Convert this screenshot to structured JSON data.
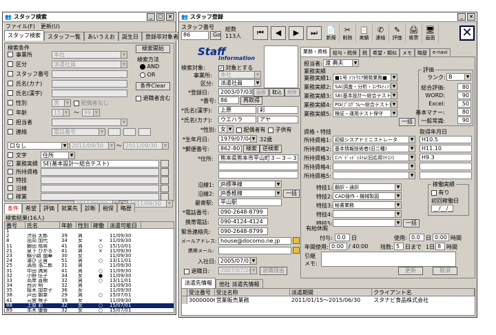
{
  "left": {
    "title": "スタッフ検索",
    "menu": [
      "ファイル(F)",
      "更新(U)"
    ],
    "tabs": [
      "スタッフ検索",
      "スタッフ一覧",
      "あいうえお",
      "誕生日",
      "登録非対象者"
    ],
    "cond_header": "検索条件",
    "search_btn": "検索開始",
    "method_label": "検索方法",
    "and": "AND",
    "or": "OR",
    "clear_btn": "条件Clear",
    "retired": "退職者含む",
    "fields": [
      {
        "label": "事業所",
        "value": "本社",
        "type": "select",
        "check": false,
        "dis": true
      },
      {
        "label": "区分",
        "value": "派遣社員",
        "type": "select",
        "check": true,
        "dis": true
      },
      {
        "label": "スタッフ番号",
        "value": "",
        "type": "text",
        "check": true,
        "dis": true
      },
      {
        "label": "氏名(カナ)",
        "value": "",
        "type": "text",
        "check": true,
        "dis": true
      },
      {
        "label": "氏名(漢字)",
        "value": "",
        "type": "text",
        "check": true,
        "dis": true
      },
      {
        "label": "性別",
        "value": "男",
        "type": "select",
        "check": true,
        "dis": true,
        "extra": "配偶者なし"
      },
      {
        "label": "年齢",
        "value": "15",
        "type": "range",
        "check": true,
        "dis": true,
        "to": "99"
      },
      {
        "label": "担当者",
        "value": "",
        "type": "select",
        "check": true,
        "dis": true
      },
      {
        "label": "連絡",
        "value": "電話番号",
        "type": "select",
        "check": true,
        "dis": true
      }
    ],
    "and_none": "口なし",
    "date_from": "2011/09/30",
    "date_to": "2011/09/30",
    "bottom_fields": [
      {
        "label": "文字",
        "value": "住所",
        "check": false
      },
      {
        "label": "業務実績",
        "value": "SE(基本設計～総合テスト)",
        "check": true
      },
      {
        "label": "所持資格",
        "value": "",
        "check": false
      },
      {
        "label": "特技",
        "value": "",
        "check": false
      },
      {
        "label": "沿線",
        "value": "",
        "check": false
      },
      {
        "label": "稼業",
        "value": "",
        "check": false
      }
    ],
    "bottom_date_from": "2011/09/30",
    "bottom_date_to": "2011/09/30",
    "subtabs": [
      "条件",
      "希望",
      "評価",
      "就業先",
      "診断",
      "税保",
      "略歴"
    ],
    "result_header": "検索結果(16人)",
    "cols": [
      "番号",
      "氏名",
      "年齢",
      "性別",
      "稼働",
      "派遣可能日"
    ],
    "rows": [
      [
        "1",
        "",
        "",
        "",
        "",
        ""
      ],
      [
        "2",
        "渋谷 太郎",
        "39",
        "男",
        "",
        "11/09/30"
      ],
      [
        "8",
        "出向 加代",
        "34",
        "女",
        "×",
        "11/09/30"
      ],
      [
        "11",
        "銀田 晴男",
        "41",
        "男",
        "○",
        "15/10/01"
      ],
      [
        "21",
        "泉下 ひかる",
        "41",
        "男",
        "×",
        "11/09/30"
      ],
      [
        "23",
        "錦小路 國華",
        "30",
        "女",
        "",
        "11/09/30"
      ],
      [
        "24",
        "濃び 正貴",
        "51",
        "男",
        "○",
        "13/11/01"
      ],
      [
        "25",
        "渦島 浩二郎",
        "31",
        "男",
        "",
        "11/09/30"
      ],
      [
        "31",
        "中田 満男",
        "41",
        "男",
        "○",
        "11/09/30"
      ],
      [
        "32",
        "小野 伍子",
        "34",
        "女",
        "●",
        "11/09/30"
      ],
      [
        "33",
        "高岸 直樹",
        "32",
        "男",
        "○",
        "13/11/01"
      ],
      [
        "34",
        "西沢 明",
        "32",
        "男",
        "",
        "11/09/30"
      ],
      [
        "35",
        "桜木 加奈子",
        "36",
        "女",
        "",
        "11/09/30"
      ],
      [
        "38",
        "戸田 朝幸",
        "29",
        "男",
        "○",
        "15/07/01"
      ],
      [
        "41",
        "元宮 咲子",
        "39",
        "女",
        "",
        "11/09/30"
      ],
      [
        "88",
        "上原 彩",
        "32",
        "女",
        "○",
        "15/07/01"
      ],
      [
        "89",
        "本木 優香",
        "32",
        "女",
        "○",
        "15/07/01"
      ]
    ],
    "selected_row": 15
  },
  "right": {
    "title": "スタッフ登録",
    "staffno_label": "スタッフ番号",
    "staffno": "86",
    "go": "Go",
    "total_label": "総数",
    "total": "113人",
    "tools": [
      {
        "icon": "new",
        "label": "新規"
      },
      {
        "icon": "del",
        "label": "削除"
      },
      {
        "icon": "done",
        "label": "実績"
      },
      {
        "icon": "contact",
        "label": "連絡"
      },
      {
        "icon": "eval",
        "label": "評価"
      },
      {
        "icon": "print",
        "label": "帳票"
      },
      {
        "icon": "screen",
        "label": "画面"
      }
    ],
    "logo1": "Staff",
    "logo2": "Information",
    "target_label": "検索対象:",
    "target": "対象とする",
    "office_label": "事業所:",
    "office": "本社",
    "class_label": "区分:",
    "class": "派遣社員",
    "reg_label": "*登録日:",
    "reg": "2003/07/03",
    "reg_btn1": "画面",
    "reg_btn2": "取込",
    "reg_btn3": "削除",
    "no_label": "*番号:",
    "no": "86",
    "renum": "再取得",
    "kanji_label": "*氏名(漢字):",
    "kanji1": "上原",
    "kanji2": "彩",
    "kana_label": "*氏名(カナ):",
    "kana1": "ウエハラ",
    "kana2": "アヤ",
    "sex_label": "*性別:",
    "sex": "女",
    "spouse": "配偶者有",
    "child": "子供有",
    "birth_label": "*生年月日:",
    "birth": "1979/07/04",
    "age": "32歳",
    "zip_label": "*郵便番号:",
    "zip": "862-8012",
    "zip_search": "検索",
    "zip_conv": "逆検索",
    "addr_label": "*住所:",
    "addr": "熊本県熊本市平山町３－３－３",
    "line1_label": "沿線1:",
    "line1": "JR標準線",
    "line2_label": "沿線2:",
    "line2": "JR香椎線",
    "line_btn": "一括",
    "station_label": "最寄駅:",
    "station": "平山駅",
    "tel_label": "*電話番号:",
    "tel": "090-2648-8799",
    "mobile_label": "携帯電話:",
    "mobile": "090-4124-4124",
    "emerg_label": "緊急連絡先:",
    "emerg": "090-2648-8799",
    "mail_label": "メールアドレス:",
    "mail": "house@docomo.ne.jp",
    "mmail_label": "携帯メール:",
    "mmail": "",
    "join_label": "入社日:",
    "join": "2005/07/03",
    "leave_label": "退職日:",
    "leave": "2007/07/26",
    "leave_btn": "退職理由",
    "rtabs": [
      "業務・資格",
      "給与・税保",
      "税",
      "希望・類似",
      "メモ",
      "略歴",
      "e-navi"
    ],
    "tanto_label": "担当者:",
    "tanto": "渡 典夫",
    "jisseki_label": "業務実績",
    "jobs": [
      {
        "label": "業務実績1:",
        "value": "■1号 ｿﾌﾄｳｴｱ開発業務■"
      },
      {
        "label": "業務実績2:",
        "value": "SA(調査・分析・ｺﾝｻﾙﾃｨﾝｸﾞ)"
      },
      {
        "label": "業務実績3:",
        "value": "SE(基本設計～総合テスト)"
      },
      {
        "label": "業務実績4:",
        "value": "PG(ﾌﾟﾛｸﾞﾗﾑ～総合テスト)"
      },
      {
        "label": "業務実績5:",
        "value": "検証・運用テスト保守"
      }
    ],
    "ikkatsu": "一括",
    "eval_label": "評価",
    "rank_label": "ランク:",
    "rank": "B",
    "evals": [
      {
        "label": "総合評価:",
        "value": "80"
      },
      {
        "label": "WORD:",
        "value": "90"
      },
      {
        "label": "Excel:",
        "value": "50"
      },
      {
        "label": "基本マナー:",
        "value": "80"
      },
      {
        "label": "一般常識:",
        "value": "90"
      }
    ],
    "shikaku_label": "資格・特技",
    "acq_label": "取得年月日",
    "quals": [
      {
        "label": "所持資格1:",
        "value": "初級シスアドミニストレータ",
        "date": "H10.5"
      },
      {
        "label": "所持資格2:",
        "value": "基本情報技術者(旧二種)",
        "date": "H11.10"
      },
      {
        "label": "所持資格3:",
        "value": "ｴﾝﾍﾞﾃﾞｯﾄﾞｼｽﾃﾑ(旧応用ﾏｲｺﾝ)",
        "date": "H9.3"
      },
      {
        "label": "所持資格4:",
        "value": "",
        "date": ""
      },
      {
        "label": "所持資格5:",
        "value": "",
        "date": ""
      }
    ],
    "skills": [
      {
        "label": "特技1:",
        "value": "翻訳・通訳"
      },
      {
        "label": "特技2:",
        "value": "CAD操作・機械製図"
      },
      {
        "label": "特技3:",
        "value": "秘書業務"
      },
      {
        "label": "特技4:",
        "value": ""
      },
      {
        "label": "特技5:",
        "value": ""
      }
    ],
    "kado_label": "稼働実績",
    "kado_chk": "有り",
    "kado_date_label": "初回稼働日",
    "kado_date": "__/__/__",
    "yukyu_label": "有給休暇",
    "fuyo_label": "付与:",
    "fuyo": "0.0",
    "nichi": "日",
    "shiyo_label": "使用:",
    "shiyo": "0.0",
    "shiyo_time": "0:00",
    "jikan": "時間",
    "nenji_label": "年間使用:",
    "nenji": "0:00",
    "nenji_of": "/ 40:00",
    "zan_label": "残数:",
    "zan": "5",
    "zan_unit": "日まで",
    "day_label": "1日",
    "hours": "8",
    "jikan2": "時間",
    "memo_label": "引継メモ:",
    "update": "更新",
    "cancel": "取消",
    "btabs": [
      "派遣先情報",
      "他社 派遣先情報"
    ],
    "bcols": [
      "受注番号",
      "受注名称",
      "派遣期間",
      "クライアント名"
    ],
    "brows": [
      [
        "30000006",
        "営業販売業務",
        "2011/01/15～2015/06/30",
        "スタナビ食品株式会社"
      ]
    ]
  }
}
